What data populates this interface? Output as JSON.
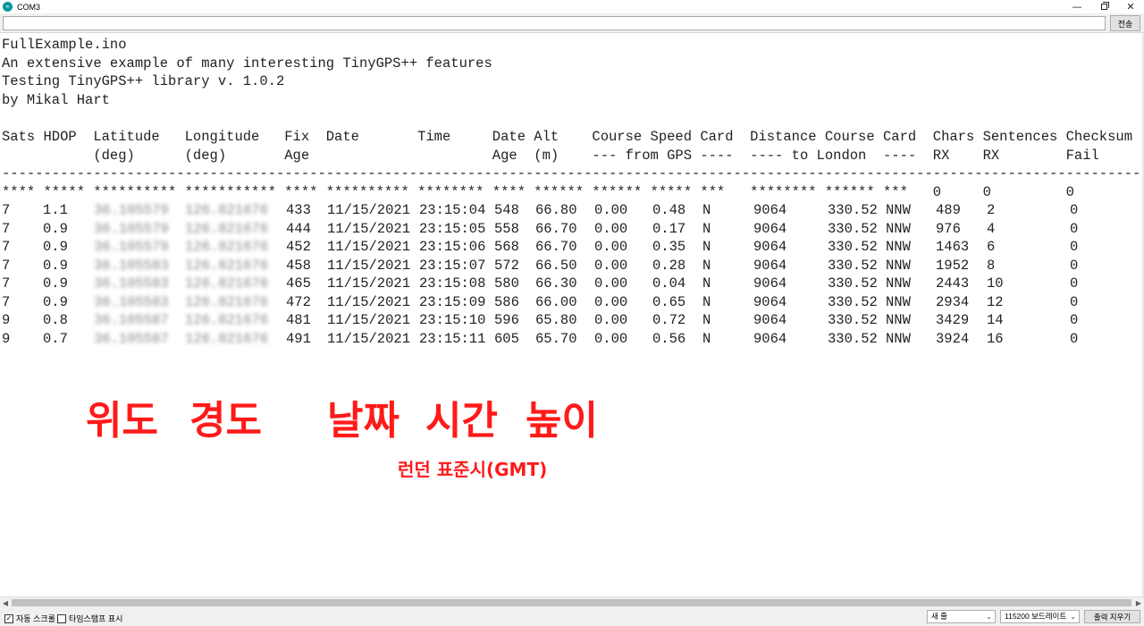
{
  "window": {
    "title": "COM3",
    "app_icon_glyph": "∞",
    "controls": [
      "—",
      "",
      "✕"
    ]
  },
  "send": {
    "input_value": "",
    "button_label": "전송"
  },
  "output": {
    "header_lines": [
      "FullExample.ino",
      "An extensive example of many interesting TinyGPS++ features",
      "Testing TinyGPS++ library v. 1.0.2",
      "by Mikal Hart"
    ],
    "columns_line1": "Sats HDOP  Latitude   Longitude   Fix  Date       Time     Date Alt    Course Speed Card  Distance Course Card  Chars Sentences Checksum",
    "columns_line2": "           (deg)      (deg)       Age                      Age  (m)    --- from GPS ----  ---- to London  ----  RX    RX        Fail",
    "separator": "---------------------------------------------------------------------------------------------------------------------------------------------",
    "invalid_line": "**** ***** ********** *********** **** ********** ******** **** ****** ****** ***** ***   ******** ****** ***   0     0         0",
    "rows": [
      {
        "sats": "7",
        "hdop": "1.1",
        "lat": "36.105579",
        "lng": "126.821676",
        "fix_age": "433",
        "date": "11/15/2021",
        "time": "23:15:04",
        "date_age": "548",
        "alt": "66.80",
        "course": "0.00",
        "speed": "0.48",
        "card": "N",
        "distance": "9064",
        "course_london": "330.52",
        "card_london": "NNW",
        "chars_rx": "489",
        "sentences_rx": "2",
        "checksum_fail": "0"
      },
      {
        "sats": "7",
        "hdop": "0.9",
        "lat": "36.105579",
        "lng": "126.821676",
        "fix_age": "444",
        "date": "11/15/2021",
        "time": "23:15:05",
        "date_age": "558",
        "alt": "66.70",
        "course": "0.00",
        "speed": "0.17",
        "card": "N",
        "distance": "9064",
        "course_london": "330.52",
        "card_london": "NNW",
        "chars_rx": "976",
        "sentences_rx": "4",
        "checksum_fail": "0"
      },
      {
        "sats": "7",
        "hdop": "0.9",
        "lat": "36.105579",
        "lng": "126.821676",
        "fix_age": "452",
        "date": "11/15/2021",
        "time": "23:15:06",
        "date_age": "568",
        "alt": "66.70",
        "course": "0.00",
        "speed": "0.35",
        "card": "N",
        "distance": "9064",
        "course_london": "330.52",
        "card_london": "NNW",
        "chars_rx": "1463",
        "sentences_rx": "6",
        "checksum_fail": "0"
      },
      {
        "sats": "7",
        "hdop": "0.9",
        "lat": "36.105583",
        "lng": "126.821676",
        "fix_age": "458",
        "date": "11/15/2021",
        "time": "23:15:07",
        "date_age": "572",
        "alt": "66.50",
        "course": "0.00",
        "speed": "0.28",
        "card": "N",
        "distance": "9064",
        "course_london": "330.52",
        "card_london": "NNW",
        "chars_rx": "1952",
        "sentences_rx": "8",
        "checksum_fail": "0"
      },
      {
        "sats": "7",
        "hdop": "0.9",
        "lat": "36.105583",
        "lng": "126.821676",
        "fix_age": "465",
        "date": "11/15/2021",
        "time": "23:15:08",
        "date_age": "580",
        "alt": "66.30",
        "course": "0.00",
        "speed": "0.04",
        "card": "N",
        "distance": "9064",
        "course_london": "330.52",
        "card_london": "NNW",
        "chars_rx": "2443",
        "sentences_rx": "10",
        "checksum_fail": "0"
      },
      {
        "sats": "7",
        "hdop": "0.9",
        "lat": "36.105583",
        "lng": "126.821676",
        "fix_age": "472",
        "date": "11/15/2021",
        "time": "23:15:09",
        "date_age": "586",
        "alt": "66.00",
        "course": "0.00",
        "speed": "0.65",
        "card": "N",
        "distance": "9064",
        "course_london": "330.52",
        "card_london": "NNW",
        "chars_rx": "2934",
        "sentences_rx": "12",
        "checksum_fail": "0"
      },
      {
        "sats": "9",
        "hdop": "0.8",
        "lat": "36.105587",
        "lng": "126.821676",
        "fix_age": "481",
        "date": "11/15/2021",
        "time": "23:15:10",
        "date_age": "596",
        "alt": "65.80",
        "course": "0.00",
        "speed": "0.72",
        "card": "N",
        "distance": "9064",
        "course_london": "330.52",
        "card_london": "NNW",
        "chars_rx": "3429",
        "sentences_rx": "14",
        "checksum_fail": "0"
      },
      {
        "sats": "9",
        "hdop": "0.7",
        "lat": "36.105587",
        "lng": "126.821676",
        "fix_age": "491",
        "date": "11/15/2021",
        "time": "23:15:11",
        "date_age": "605",
        "alt": "65.70",
        "course": "0.00",
        "speed": "0.56",
        "card": "N",
        "distance": "9064",
        "course_london": "330.52",
        "card_london": "NNW",
        "chars_rx": "3924",
        "sentences_rx": "16",
        "checksum_fail": "0"
      }
    ]
  },
  "annotations": {
    "latitude": "위도",
    "longitude": "경도",
    "date": "날짜",
    "time": "시간",
    "altitude": "높이",
    "gmt_note": "런던 표준시(GMT)",
    "color": "#ff1a1a"
  },
  "scrollbar": {
    "left_arrow": "◀",
    "right_arrow": "▶"
  },
  "bottom": {
    "autoscroll_label": "자동 스크롤",
    "autoscroll_checked": true,
    "autoscroll_mark": "✓",
    "timestamp_label": "타임스탬프 표시",
    "timestamp_checked": false,
    "line_ending": "새 줄",
    "baud_rate": "115200 보드레이트",
    "caret": "⌄",
    "clear_label": "출력 지우기"
  }
}
